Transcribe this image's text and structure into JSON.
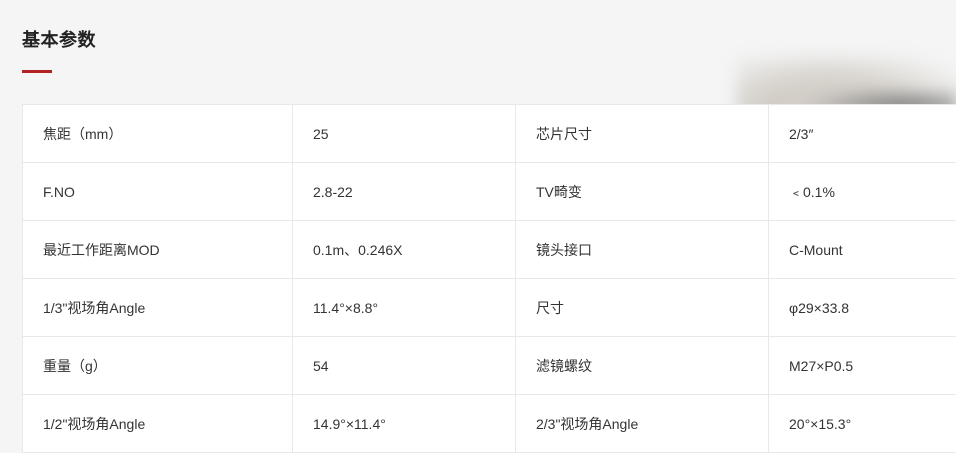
{
  "section": {
    "title": "基本参数"
  },
  "specs": [
    {
      "label1": "焦距（mm）",
      "value1": "25",
      "label2": "芯片尺寸",
      "value2": "2/3″"
    },
    {
      "label1": "F.NO",
      "value1": "2.8-22",
      "label2": "TV畸变",
      "value2": "﹤0.1%"
    },
    {
      "label1": "最近工作距离MOD",
      "value1": "0.1m、0.246X",
      "label2": "镜头接口",
      "value2": "C-Mount"
    },
    {
      "label1": "1/3\"视场角Angle",
      "value1": "11.4°×8.8°",
      "label2": "尺寸",
      "value2": "φ29×33.8"
    },
    {
      "label1": "重量（g）",
      "value1": "54",
      "label2": "滤镜螺纹",
      "value2": "M27×P0.5"
    },
    {
      "label1": "1/2\"视场角Angle",
      "value1": "14.9°×11.4°",
      "label2": "2/3\"视场角Angle",
      "value2": "20°×15.3°"
    }
  ],
  "colors": {
    "accent": "#b22222",
    "background": "#f5f5f5",
    "table_border": "#e8e8e8"
  }
}
